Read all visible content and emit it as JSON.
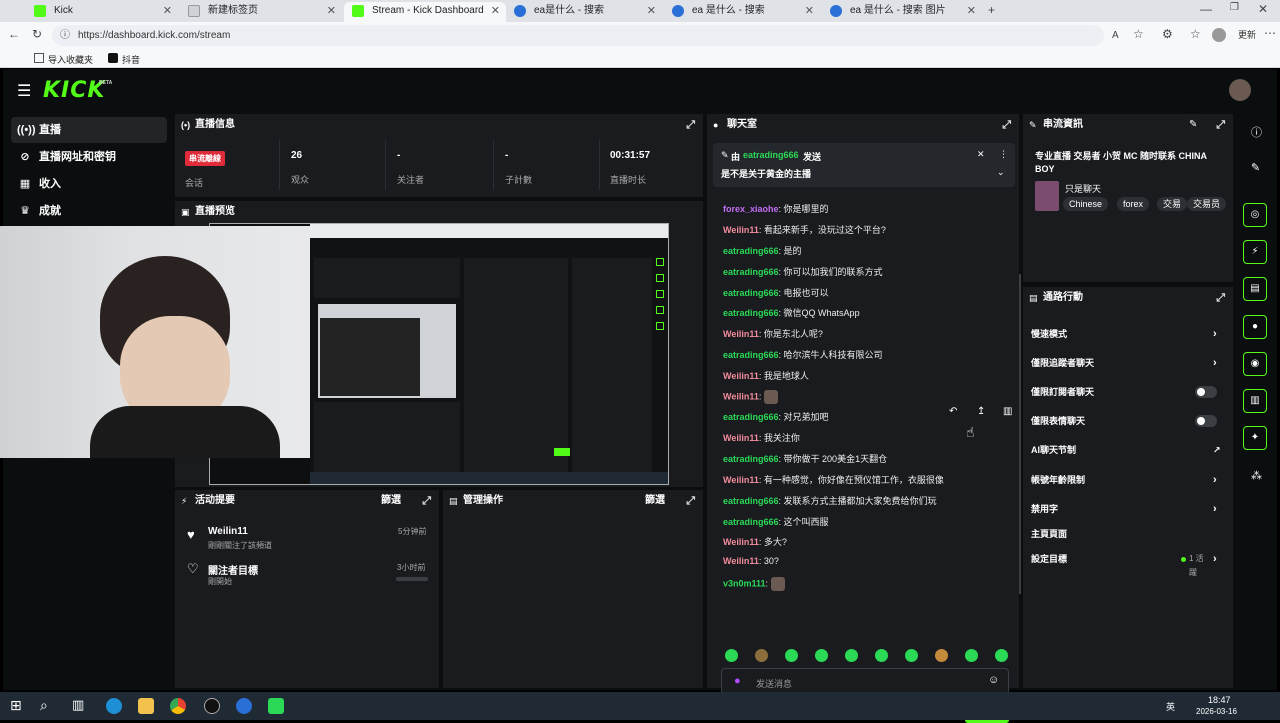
{
  "browser": {
    "tabs": [
      {
        "label": "Kick",
        "color": "#53fc18"
      },
      {
        "label": "新建标签页",
        "color": "#cfd3d8"
      },
      {
        "label": "Stream - Kick Dashboard",
        "color": "#53fc18"
      },
      {
        "label": "ea是什么 - 搜索",
        "color": "#2a6fd6"
      },
      {
        "label": "ea 是什么 - 搜索",
        "color": "#2a6fd6"
      },
      {
        "label": "ea 是什么 - 搜索 图片",
        "color": "#2a6fd6"
      }
    ],
    "url": "https://dashboard.kick.com/stream",
    "bookmarks": [
      "导入收藏夹",
      "抖音"
    ],
    "profile_label": "更新"
  },
  "app": {
    "logo": "KICK",
    "logo_badge": "BETA",
    "sidebar": [
      {
        "label": "直播",
        "icon": "broadcast-icon"
      },
      {
        "label": "直播网址和密钥",
        "icon": "link-icon"
      },
      {
        "label": "收入",
        "icon": "revenue-icon"
      },
      {
        "label": "成就",
        "icon": "trophy-icon"
      }
    ]
  },
  "stream_info": {
    "title": "直播信息",
    "live_badge": "串流離線",
    "session_label": "会话",
    "stats": [
      {
        "value": "26",
        "label": "观众"
      },
      {
        "value": "-",
        "label": "关注者"
      },
      {
        "value": "-",
        "label": "子計數"
      },
      {
        "value": "00:31:57",
        "label": "直播时长"
      }
    ]
  },
  "preview": {
    "title": "直播预览"
  },
  "activity": {
    "title": "活动提要",
    "filter": "篩選",
    "items": [
      {
        "user": "Weilin11",
        "desc": "剛剛關注了該頻道",
        "time": "5分钟前"
      },
      {
        "user": "關注者目標",
        "desc": "剛開始",
        "time": "3小时前"
      }
    ]
  },
  "mod": {
    "title": "管理操作",
    "filter": "篩選"
  },
  "chat": {
    "title": "聊天室",
    "pinned_by": "由",
    "pinned_user": "eatrading666",
    "pinned_suffix": "发送",
    "pinned_text": "是不是关于黄金的主播",
    "messages": [
      {
        "user": "forex_xiaohe",
        "color": "#c36ef5",
        "text": "你是哪里的"
      },
      {
        "user": "Weilin11",
        "color": "#f28b9b",
        "text": "看起来新手，没玩过这个平台?"
      },
      {
        "user": "eatrading666",
        "color": "#2bd957",
        "text": "是的"
      },
      {
        "user": "eatrading666",
        "color": "#2bd957",
        "text": "你可以加我们的联系方式"
      },
      {
        "user": "eatrading666",
        "color": "#2bd957",
        "text": "电报也可以"
      },
      {
        "user": "eatrading666",
        "color": "#2bd957",
        "text": "微信QQ WhatsApp"
      },
      {
        "user": "Weilin11",
        "color": "#f28b9b",
        "text": "你是东北人呢?"
      },
      {
        "user": "eatrading666",
        "color": "#2bd957",
        "text": "哈尔滨牛人科技有限公司"
      },
      {
        "user": "Weilin11",
        "color": "#f28b9b",
        "text": "我是地球人"
      },
      {
        "user": "Weilin11",
        "color": "#f28b9b",
        "text": ""
      },
      {
        "user": "eatrading666",
        "color": "#2bd957",
        "text": "对兄弟加吧"
      },
      {
        "user": "Weilin11",
        "color": "#f28b9b",
        "text": "我关注你"
      },
      {
        "user": "eatrading666",
        "color": "#2bd957",
        "text": "带你做干 200美金1天翻仓"
      },
      {
        "user": "Weilin11",
        "color": "#f28b9b",
        "text": "有一种感觉，你好像在预仪馆工作，衣服很像"
      },
      {
        "user": "eatrading666",
        "color": "#2bd957",
        "text": "发联系方式主播都加大家免费给你们玩"
      },
      {
        "user": "eatrading666",
        "color": "#2bd957",
        "text": "这个叫西服"
      },
      {
        "user": "Weilin11",
        "color": "#f28b9b",
        "text": "多大?"
      },
      {
        "user": "Weilin11",
        "color": "#f28b9b",
        "text": "30?"
      },
      {
        "user": "v3n0m111",
        "color": "#2bd957",
        "text": ""
      }
    ],
    "input_placeholder": "发送消息",
    "send_label": "聊天室"
  },
  "stream_profile": {
    "title": "串流資訊",
    "stream_title": "专业直播 交易者 小贺 MC 随时联系 CHINA BOY",
    "category": "只是聊天",
    "tags": [
      "Chinese",
      "forex",
      "交易",
      "交易员"
    ]
  },
  "quick_actions": {
    "title": "通路行動",
    "items": [
      {
        "label": "慢速模式",
        "control": "chevron"
      },
      {
        "label": "僅限追蹤者聊天",
        "control": "chevron"
      },
      {
        "label": "僅限訂閱者聊天",
        "control": "toggle"
      },
      {
        "label": "僅限表情聊天",
        "control": "toggle"
      },
      {
        "label": "AI聊天节制",
        "control": "external"
      },
      {
        "label": "帳號年齡限制",
        "control": "chevron"
      },
      {
        "label": "禁用字",
        "control": "chevron"
      },
      {
        "label": "主頁頁面",
        "control": "none"
      },
      {
        "label": "設定目標",
        "control": "chevron"
      }
    ],
    "goal_status": "1 活躍"
  },
  "taskbar": {
    "time": "18:47",
    "date": "2026-03-16",
    "lang": "英"
  },
  "colors": {
    "accent": "#53fc18",
    "panel": "#191b1f",
    "bg": "#0b0e0f",
    "live": "#e02b3a"
  }
}
